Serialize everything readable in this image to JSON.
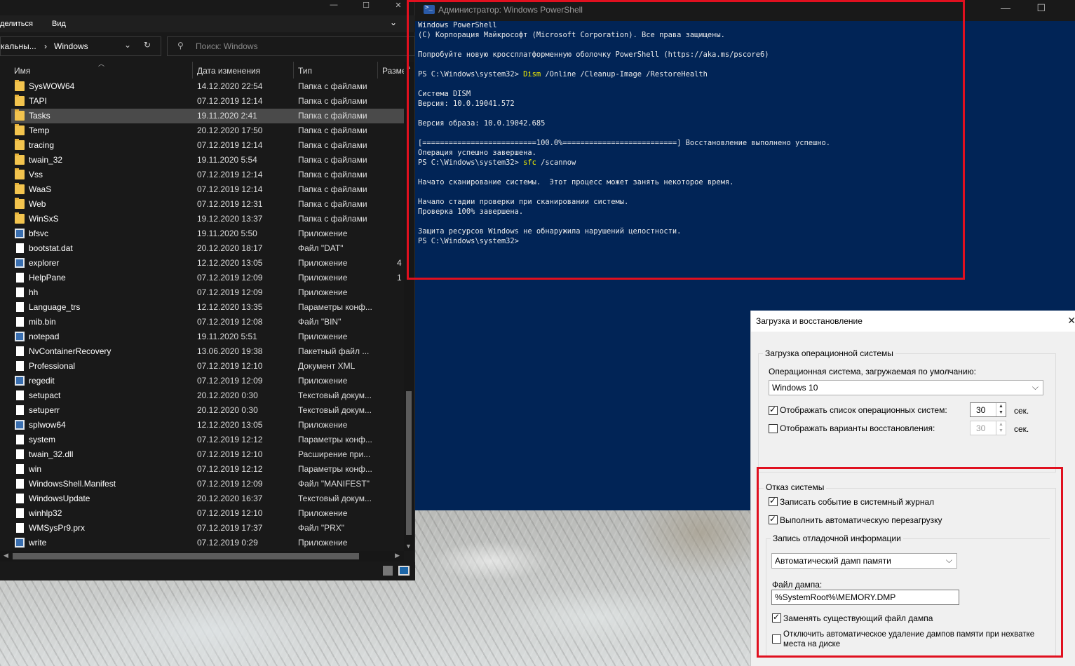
{
  "explorer": {
    "ribbon": {
      "share": "делиться",
      "view": "Вид"
    },
    "address": {
      "prev": "кальны...",
      "separator": "›",
      "current": "Windows"
    },
    "search": {
      "placeholder": "Поиск: Windows"
    },
    "columns": {
      "name": "Имя",
      "date": "Дата изменения",
      "type": "Тип",
      "size": "Разме"
    },
    "files": [
      {
        "name": "SysWOW64",
        "date": "14.12.2020 22:54",
        "type": "Папка с файлами",
        "size": "",
        "icon": "folder-icon"
      },
      {
        "name": "TAPI",
        "date": "07.12.2019 12:14",
        "type": "Папка с файлами",
        "size": "",
        "icon": "folder-icon"
      },
      {
        "name": "Tasks",
        "date": "19.11.2020 2:41",
        "type": "Папка с файлами",
        "size": "",
        "icon": "folder-icon",
        "selected": true
      },
      {
        "name": "Temp",
        "date": "20.12.2020 17:50",
        "type": "Папка с файлами",
        "size": "",
        "icon": "folder-icon"
      },
      {
        "name": "tracing",
        "date": "07.12.2019 12:14",
        "type": "Папка с файлами",
        "size": "",
        "icon": "folder-icon"
      },
      {
        "name": "twain_32",
        "date": "19.11.2020 5:54",
        "type": "Папка с файлами",
        "size": "",
        "icon": "folder-icon"
      },
      {
        "name": "Vss",
        "date": "07.12.2019 12:14",
        "type": "Папка с файлами",
        "size": "",
        "icon": "folder-icon"
      },
      {
        "name": "WaaS",
        "date": "07.12.2019 12:14",
        "type": "Папка с файлами",
        "size": "",
        "icon": "folder-icon"
      },
      {
        "name": "Web",
        "date": "07.12.2019 12:31",
        "type": "Папка с файлами",
        "size": "",
        "icon": "folder-icon"
      },
      {
        "name": "WinSxS",
        "date": "19.12.2020 13:37",
        "type": "Папка с файлами",
        "size": "",
        "icon": "folder-icon"
      },
      {
        "name": "bfsvc",
        "date": "19.11.2020 5:50",
        "type": "Приложение",
        "size": "",
        "icon": "app-icon"
      },
      {
        "name": "bootstat.dat",
        "date": "20.12.2020 18:17",
        "type": "Файл \"DAT\"",
        "size": "",
        "icon": "file-icon"
      },
      {
        "name": "explorer",
        "date": "12.12.2020 13:05",
        "type": "Приложение",
        "size": "4",
        "icon": "explorer-icon"
      },
      {
        "name": "HelpPane",
        "date": "07.12.2019 12:09",
        "type": "Приложение",
        "size": "1",
        "icon": "help-icon"
      },
      {
        "name": "hh",
        "date": "07.12.2019 12:09",
        "type": "Приложение",
        "size": "",
        "icon": "help-file-icon"
      },
      {
        "name": "Language_trs",
        "date": "12.12.2020 13:35",
        "type": "Параметры конф...",
        "size": "",
        "icon": "config-icon"
      },
      {
        "name": "mib.bin",
        "date": "07.12.2019 12:08",
        "type": "Файл \"BIN\"",
        "size": "",
        "icon": "file-icon"
      },
      {
        "name": "notepad",
        "date": "19.11.2020 5:51",
        "type": "Приложение",
        "size": "",
        "icon": "notepad-icon"
      },
      {
        "name": "NvContainerRecovery",
        "date": "13.06.2020 19:38",
        "type": "Пакетный файл ...",
        "size": "",
        "icon": "batch-file-icon"
      },
      {
        "name": "Professional",
        "date": "07.12.2019 12:10",
        "type": "Документ XML",
        "size": "",
        "icon": "xml-file-icon"
      },
      {
        "name": "regedit",
        "date": "07.12.2019 12:09",
        "type": "Приложение",
        "size": "",
        "icon": "regedit-icon"
      },
      {
        "name": "setupact",
        "date": "20.12.2020 0:30",
        "type": "Текстовый докум...",
        "size": "",
        "icon": "text-file-icon"
      },
      {
        "name": "setuperr",
        "date": "20.12.2020 0:30",
        "type": "Текстовый докум...",
        "size": "",
        "icon": "text-file-icon"
      },
      {
        "name": "splwow64",
        "date": "12.12.2020 13:05",
        "type": "Приложение",
        "size": "",
        "icon": "printer-icon"
      },
      {
        "name": "system",
        "date": "07.12.2019 12:12",
        "type": "Параметры конф...",
        "size": "",
        "icon": "config-icon"
      },
      {
        "name": "twain_32.dll",
        "date": "07.12.2019 12:10",
        "type": "Расширение при...",
        "size": "",
        "icon": "dll-icon"
      },
      {
        "name": "win",
        "date": "07.12.2019 12:12",
        "type": "Параметры конф...",
        "size": "",
        "icon": "config-icon"
      },
      {
        "name": "WindowsShell.Manifest",
        "date": "07.12.2019 12:09",
        "type": "Файл \"MANIFEST\"",
        "size": "",
        "icon": "file-icon"
      },
      {
        "name": "WindowsUpdate",
        "date": "20.12.2020 16:37",
        "type": "Текстовый докум...",
        "size": "",
        "icon": "text-file-icon"
      },
      {
        "name": "winhlp32",
        "date": "07.12.2019 12:10",
        "type": "Приложение",
        "size": "",
        "icon": "help-question-icon"
      },
      {
        "name": "WMSysPr9.prx",
        "date": "07.12.2019 17:37",
        "type": "Файл \"PRX\"",
        "size": "",
        "icon": "file-icon"
      },
      {
        "name": "write",
        "date": "07.12.2019 0:29",
        "type": "Приложение",
        "size": "",
        "icon": "write-icon"
      }
    ]
  },
  "powershell": {
    "title": "Администратор: Windows PowerShell",
    "lines": [
      {
        "t": "Windows PowerShell"
      },
      {
        "t": "(C) Корпорация Майкрософт (Microsoft Corporation). Все права защищены."
      },
      {
        "t": ""
      },
      {
        "t": "Попробуйте новую кроссплатформенную оболочку PowerShell (https://aka.ms/pscore6)"
      },
      {
        "t": ""
      },
      {
        "t": "PS C:\\Windows\\system32> ",
        "cmd": "Dism",
        "args": " /Online /Cleanup-Image /RestoreHealth"
      },
      {
        "t": ""
      },
      {
        "t": "Система DISM"
      },
      {
        "t": "Версия: 10.0.19041.572"
      },
      {
        "t": ""
      },
      {
        "t": "Версия образа: 10.0.19042.685"
      },
      {
        "t": ""
      },
      {
        "t": "[==========================100.0%==========================] Восстановление выполнено успешно."
      },
      {
        "t": "Операция успешно завершена."
      },
      {
        "t": "PS C:\\Windows\\system32> ",
        "cmd": "sfc",
        "args": " /scannow"
      },
      {
        "t": ""
      },
      {
        "t": "Начато сканирование системы.  Этот процесс может занять некоторое время."
      },
      {
        "t": ""
      },
      {
        "t": "Начало стадии проверки при сканировании системы."
      },
      {
        "t": "Проверка 100% завершена."
      },
      {
        "t": ""
      },
      {
        "t": "Защита ресурсов Windows не обнаружила нарушений целостности."
      },
      {
        "t": "PS C:\\Windows\\system32>"
      }
    ]
  },
  "dialog": {
    "title": "Загрузка и восстановление",
    "os_group": {
      "title": "Загрузка операционной системы",
      "default_os_label": "Операционная система, загружаемая по умолчанию:",
      "default_os_value": "Windows 10",
      "show_list_label": "Отображать список операционных систем:",
      "show_list_checked": true,
      "show_list_value": "30",
      "show_recovery_label": "Отображать варианты восстановления:",
      "show_recovery_checked": false,
      "show_recovery_value": "30",
      "sec": "сек."
    },
    "failure_group": {
      "title": "Отказ системы",
      "log_event_label": "Записать событие в системный журнал",
      "log_event_checked": true,
      "auto_restart_label": "Выполнить автоматическую перезагрузку",
      "auto_restart_checked": true,
      "debug_group_title": "Запись отладочной информации",
      "dump_type": "Автоматический дамп памяти",
      "dump_file_label": "Файл дампа:",
      "dump_file_value": "%SystemRoot%\\MEMORY.DMP",
      "overwrite_label": "Заменять существующий файл дампа",
      "overwrite_checked": true,
      "disable_auto_delete_label_1": "Отключить автоматическое удаление дампов памяти при нехватке",
      "disable_auto_delete_label_2": "места на диске",
      "disable_auto_delete_checked": false
    }
  },
  "colors": {
    "ps_bg": "#012456",
    "ps_cmd": "#f4f000",
    "highlight_box": "#e0101f",
    "explorer_bg": "#191919"
  }
}
